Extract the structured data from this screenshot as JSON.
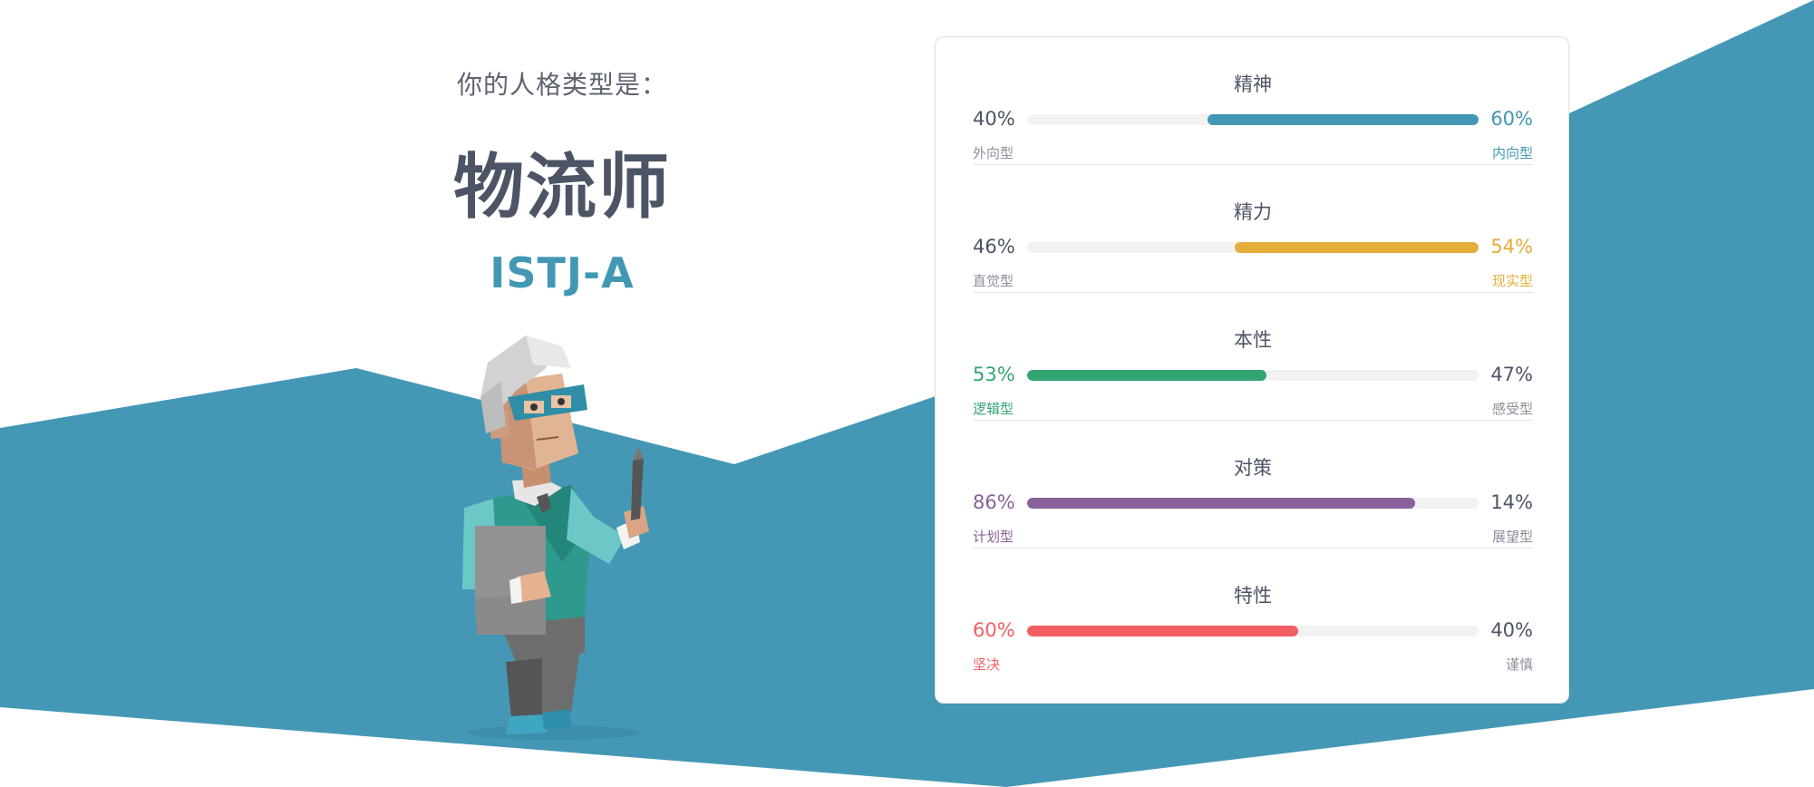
{
  "result": {
    "prompt": "你的人格类型是：",
    "type_name": "物流师",
    "type_code": "ISTJ-A"
  },
  "colors": {
    "wave": "#4598b5",
    "text_dark": "#4c5465",
    "text_muted": "#8a8f99",
    "track": "#f2f2f3"
  },
  "traits": [
    {
      "title": "精神",
      "left_pct": "40%",
      "right_pct": "60%",
      "left_label": "外向型",
      "right_label": "内向型",
      "dominant": "right",
      "fill_fraction": 0.6,
      "color": "#4298b4"
    },
    {
      "title": "精力",
      "left_pct": "46%",
      "right_pct": "54%",
      "left_label": "直觉型",
      "right_label": "现实型",
      "dominant": "right",
      "fill_fraction": 0.54,
      "color": "#e4ae3a"
    },
    {
      "title": "本性",
      "left_pct": "53%",
      "right_pct": "47%",
      "left_label": "逻辑型",
      "right_label": "感受型",
      "dominant": "left",
      "fill_fraction": 0.53,
      "color": "#33a474"
    },
    {
      "title": "对策",
      "left_pct": "86%",
      "right_pct": "14%",
      "left_label": "计划型",
      "right_label": "展望型",
      "dominant": "left",
      "fill_fraction": 0.86,
      "color": "#88619a"
    },
    {
      "title": "特性",
      "left_pct": "60%",
      "right_pct": "40%",
      "left_label": "坚决",
      "right_label": "谨慎",
      "dominant": "left",
      "fill_fraction": 0.6,
      "color": "#f25e62"
    }
  ]
}
